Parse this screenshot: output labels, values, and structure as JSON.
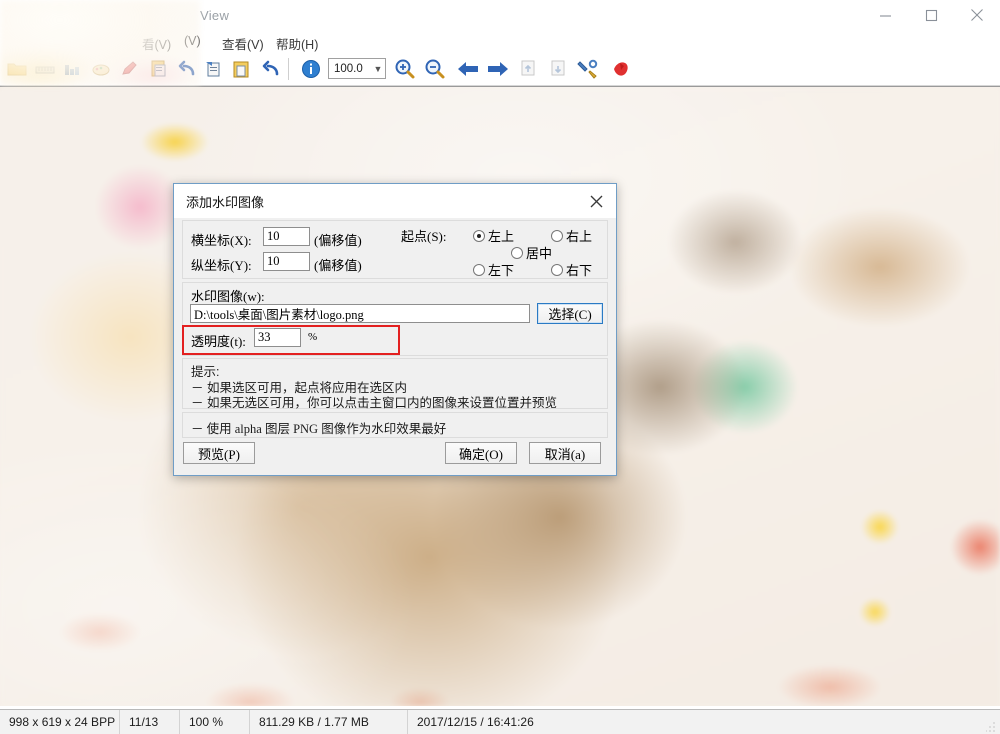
{
  "window": {
    "title": "View",
    "controls": {
      "minimize": "minimize-icon",
      "maximize": "maximize-icon",
      "close": "close-icon"
    }
  },
  "menubar": {
    "items": [
      {
        "label": "看(V)",
        "name": "menu-obscured-1"
      },
      {
        "label": "(V)",
        "name": "menu-obscured-2"
      },
      {
        "label": "查看(V)",
        "name": "menu-view"
      },
      {
        "label": "帮助(H)",
        "name": "menu-help"
      }
    ]
  },
  "toolbar": {
    "zoom_value": "100.0",
    "icons": [
      "open-folder-icon",
      "ruler-icon",
      "histogram-icon",
      "palette-icon",
      "pen-icon",
      "copy-icon",
      "undo-icon",
      "paste-special-icon",
      "paste-icon",
      "redo-icon",
      "info-icon",
      "zoom-in-icon",
      "zoom-out-icon",
      "back-arrow-icon",
      "forward-arrow-icon",
      "prev-page-icon",
      "next-page-icon",
      "tools-icon",
      "quit-icon"
    ]
  },
  "dialog": {
    "title": "添加水印图像",
    "close_label": "✕",
    "coords": {
      "x_label": "横坐标(X):",
      "x_value": "10",
      "x_suffix": "(偏移值)",
      "y_label": "纵坐标(Y):",
      "y_value": "10",
      "y_suffix": "(偏移值)"
    },
    "anchor": {
      "label": "起点(S):",
      "options": [
        {
          "label": "左上",
          "selected": true,
          "name": "radio-top-left"
        },
        {
          "label": "右上",
          "selected": false,
          "name": "radio-top-right"
        },
        {
          "label": "居中",
          "selected": false,
          "name": "radio-center"
        },
        {
          "label": "左下",
          "selected": false,
          "name": "radio-bottom-left"
        },
        {
          "label": "右下",
          "selected": false,
          "name": "radio-bottom-right"
        }
      ]
    },
    "watermark": {
      "label": "水印图像(w):",
      "path": "D:\\tools\\桌面\\图片素材\\logo.png",
      "browse_label": "选择(C)"
    },
    "transparency": {
      "label": "透明度(t):",
      "value": "33",
      "unit": "%",
      "highlight_color": "#e32020"
    },
    "hints": {
      "title": "提示:",
      "line1": "－ 如果选区可用，起点将应用在选区内",
      "line2": "－ 如果无选区可用，你可以点击主窗口内的图像来设置位置并预览",
      "line3": "－ 使用 alpha 图层 PNG 图像作为水印效果最好"
    },
    "buttons": {
      "preview": "预览(P)",
      "ok": "确定(O)",
      "cancel": "取消(a)"
    }
  },
  "statusbar": {
    "dimensions": "998 x 619 x 24 BPP",
    "page": "11/13",
    "zoom": "100 %",
    "size": "811.29 KB / 1.77 MB",
    "datetime": "2017/12/15 / 16:41:26"
  }
}
